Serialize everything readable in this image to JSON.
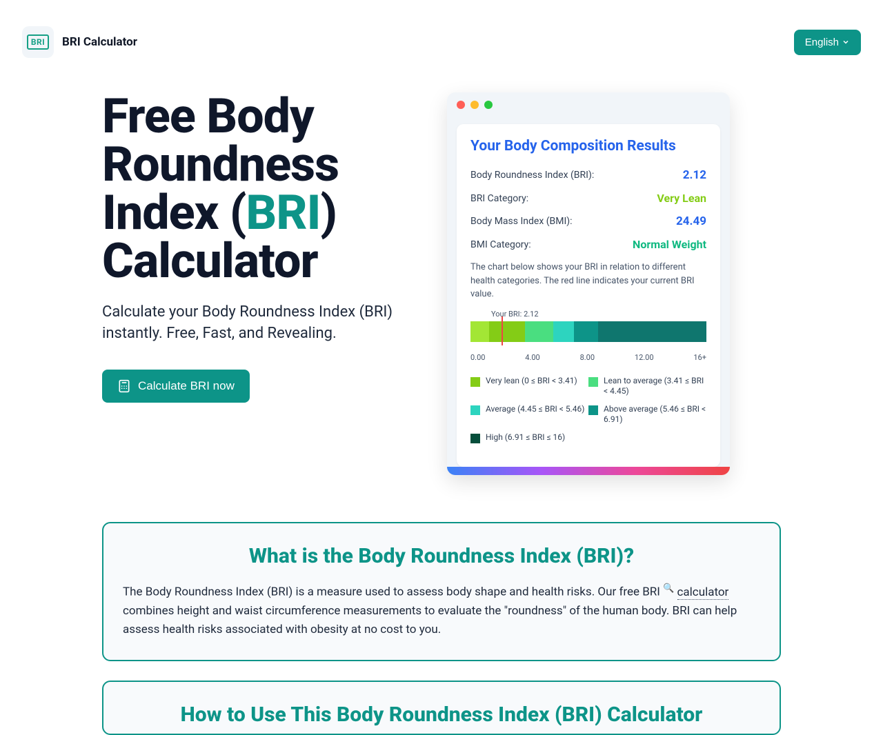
{
  "header": {
    "logo_abbr": "BRI",
    "site_name": "BRI Calculator",
    "language": "English"
  },
  "hero": {
    "title_pre": "Free Body Roundness Index (",
    "title_accent": "BRI",
    "title_post": ") Calculator",
    "subtitle": "Calculate your Body Roundness Index (BRI) instantly. Free, Fast, and Revealing.",
    "cta": "Calculate BRI now"
  },
  "results": {
    "heading": "Your Body Composition Results",
    "rows": {
      "bri_label": "Body Roundness Index (BRI):",
      "bri_value": "2.12",
      "bri_cat_label": "BRI Category:",
      "bri_cat_value": "Very Lean",
      "bmi_label": "Body Mass Index (BMI):",
      "bmi_value": "24.49",
      "bmi_cat_label": "BMI Category:",
      "bmi_cat_value": "Normal Weight"
    },
    "chart_desc": "The chart below shows your BRI in relation to different health categories. The red line indicates your current BRI value.",
    "your_bri_label": "Your BRI: 2.12",
    "ticks": {
      "t0": "0.00",
      "t1": "4.00",
      "t2": "8.00",
      "t3": "12.00",
      "t4": "16+"
    },
    "legend": {
      "l1": "Very lean (0 ≤ BRI < 3.41)",
      "l2": "Lean to average (3.41 ≤ BRI < 4.45)",
      "l3": "Average (4.45 ≤ BRI < 5.46)",
      "l4": "Above average (5.46 ≤ BRI < 6.91)",
      "l5": "High (6.91 ≤ BRI ≤ 16)"
    }
  },
  "info1": {
    "title": "What is the Body Roundness Index (BRI)?",
    "body_pre": "The Body Roundness Index (BRI) is a measure used to assess body shape and health risks. Our free BRI ",
    "body_underline": "calculator",
    "body_post": " combines height and waist circumference measurements to evaluate the \"roundness\" of the human body. BRI can help assess health risks associated with obesity at no cost to you."
  },
  "info2": {
    "title": "How to Use This Body Roundness Index (BRI) Calculator"
  }
}
